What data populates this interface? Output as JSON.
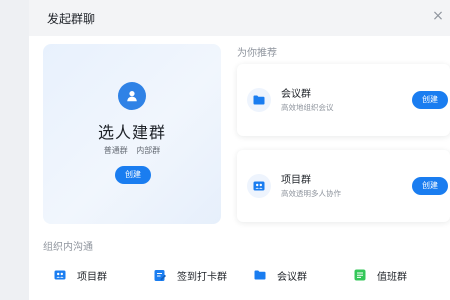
{
  "header": {
    "title": "发起群聊",
    "close_symbol": "×"
  },
  "create_card": {
    "title": "选人建群",
    "tags": [
      "普通群",
      "内部群"
    ],
    "button_label": "创建"
  },
  "recommend": {
    "heading": "为你推荐",
    "cards": [
      {
        "title": "会议群",
        "subtitle": "高效地组织会议",
        "button_label": "创建",
        "icon": "folder-icon"
      },
      {
        "title": "项目群",
        "subtitle": "高效透明多人协作",
        "button_label": "创建",
        "icon": "team-icon"
      }
    ]
  },
  "org": {
    "heading": "组织内沟通",
    "items": [
      {
        "label": "项目群",
        "icon": "team-icon"
      },
      {
        "label": "签到打卡群",
        "icon": "checkin-icon"
      },
      {
        "label": "会议群",
        "icon": "folder-icon"
      },
      {
        "label": "值班群",
        "icon": "duty-icon"
      }
    ]
  },
  "colors": {
    "accent": "#1a7df0",
    "avatar_blue": "#2f82e6",
    "header_bg": "#f3f4f6",
    "duty_green": "#34c759"
  }
}
